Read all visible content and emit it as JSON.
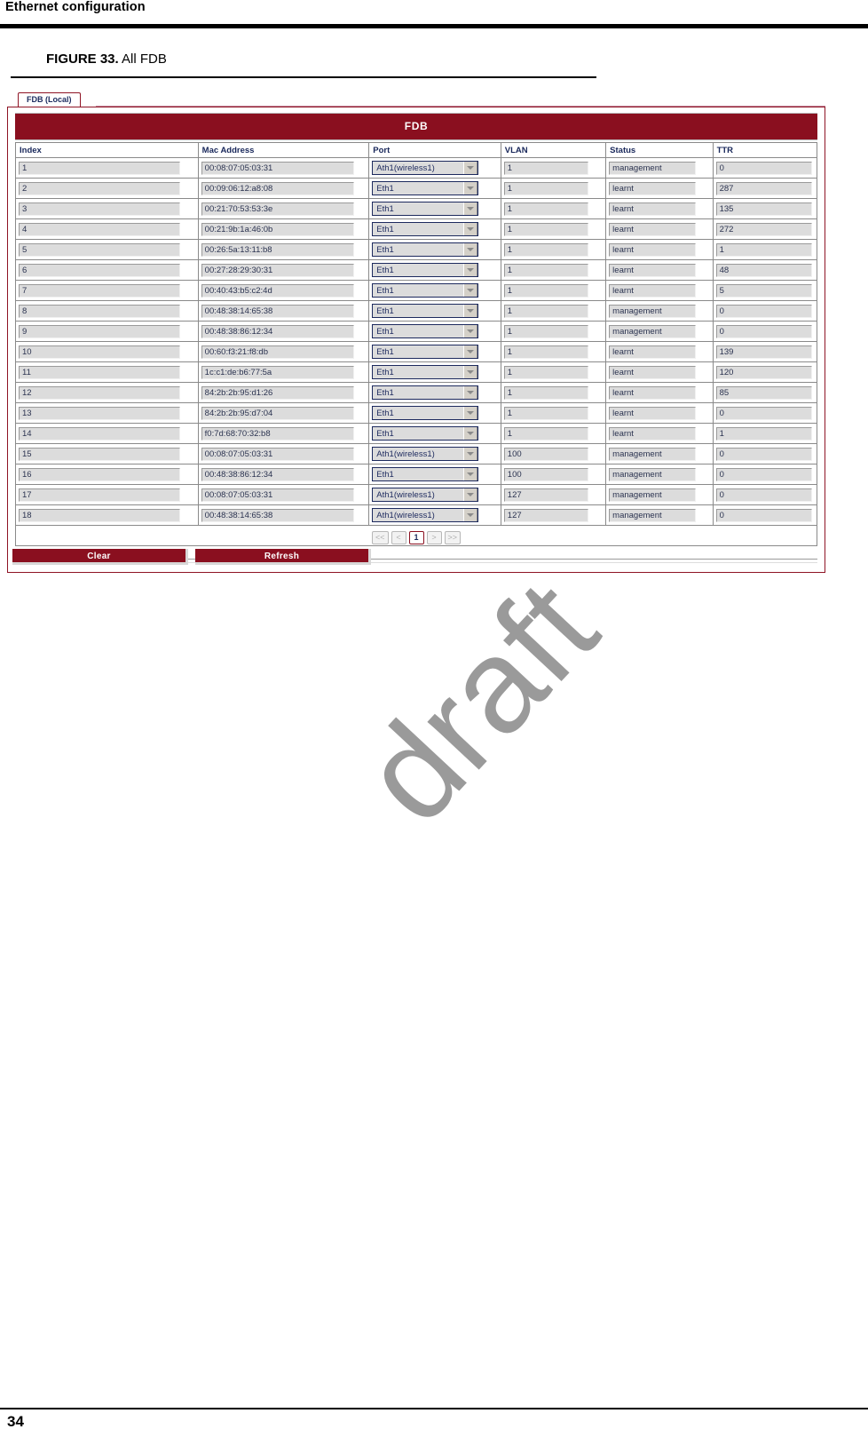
{
  "page": {
    "running_head": "Ethernet configuration",
    "page_number": "34",
    "watermark": "draft"
  },
  "figure": {
    "label": "FIGURE 33.",
    "title": "All FDB"
  },
  "screenshot": {
    "tab": {
      "label": "FDB (Local)"
    },
    "banner_title": "FDB",
    "table": {
      "columns": [
        "Index",
        "Mac Address",
        "Port",
        "VLAN",
        "Status",
        "TTR"
      ],
      "rows": [
        {
          "index": "1",
          "mac": "00:08:07:05:03:31",
          "port": "Ath1(wireless1)",
          "vlan": "1",
          "status": "management",
          "ttr": "0"
        },
        {
          "index": "2",
          "mac": "00:09:06:12:a8:08",
          "port": "Eth1",
          "vlan": "1",
          "status": "learnt",
          "ttr": "287"
        },
        {
          "index": "3",
          "mac": "00:21:70:53:53:3e",
          "port": "Eth1",
          "vlan": "1",
          "status": "learnt",
          "ttr": "135"
        },
        {
          "index": "4",
          "mac": "00:21:9b:1a:46:0b",
          "port": "Eth1",
          "vlan": "1",
          "status": "learnt",
          "ttr": "272"
        },
        {
          "index": "5",
          "mac": "00:26:5a:13:11:b8",
          "port": "Eth1",
          "vlan": "1",
          "status": "learnt",
          "ttr": "1"
        },
        {
          "index": "6",
          "mac": "00:27:28:29:30:31",
          "port": "Eth1",
          "vlan": "1",
          "status": "learnt",
          "ttr": "48"
        },
        {
          "index": "7",
          "mac": "00:40:43:b5:c2:4d",
          "port": "Eth1",
          "vlan": "1",
          "status": "learnt",
          "ttr": "5"
        },
        {
          "index": "8",
          "mac": "00:48:38:14:65:38",
          "port": "Eth1",
          "vlan": "1",
          "status": "management",
          "ttr": "0"
        },
        {
          "index": "9",
          "mac": "00:48:38:86:12:34",
          "port": "Eth1",
          "vlan": "1",
          "status": "management",
          "ttr": "0"
        },
        {
          "index": "10",
          "mac": "00:60:f3:21:f8:db",
          "port": "Eth1",
          "vlan": "1",
          "status": "learnt",
          "ttr": "139"
        },
        {
          "index": "11",
          "mac": "1c:c1:de:b6:77:5a",
          "port": "Eth1",
          "vlan": "1",
          "status": "learnt",
          "ttr": "120"
        },
        {
          "index": "12",
          "mac": "84:2b:2b:95:d1:26",
          "port": "Eth1",
          "vlan": "1",
          "status": "learnt",
          "ttr": "85"
        },
        {
          "index": "13",
          "mac": "84:2b:2b:95:d7:04",
          "port": "Eth1",
          "vlan": "1",
          "status": "learnt",
          "ttr": "0"
        },
        {
          "index": "14",
          "mac": "f0:7d:68:70:32:b8",
          "port": "Eth1",
          "vlan": "1",
          "status": "learnt",
          "ttr": "1"
        },
        {
          "index": "15",
          "mac": "00:08:07:05:03:31",
          "port": "Ath1(wireless1)",
          "vlan": "100",
          "status": "management",
          "ttr": "0"
        },
        {
          "index": "16",
          "mac": "00:48:38:86:12:34",
          "port": "Eth1",
          "vlan": "100",
          "status": "management",
          "ttr": "0"
        },
        {
          "index": "17",
          "mac": "00:08:07:05:03:31",
          "port": "Ath1(wireless1)",
          "vlan": "127",
          "status": "management",
          "ttr": "0"
        },
        {
          "index": "18",
          "mac": "00:48:38:14:65:38",
          "port": "Ath1(wireless1)",
          "vlan": "127",
          "status": "management",
          "ttr": "0"
        }
      ]
    },
    "pagination": {
      "first": "<<",
      "prev": "<",
      "current": "1",
      "next": ">",
      "last": ">>"
    },
    "buttons": {
      "clear": "Clear",
      "refresh": "Refresh"
    }
  },
  "colors": {
    "brand_red": "#8a0f1f",
    "header_text": "#18275a",
    "field_bg": "#dcdcdc"
  }
}
